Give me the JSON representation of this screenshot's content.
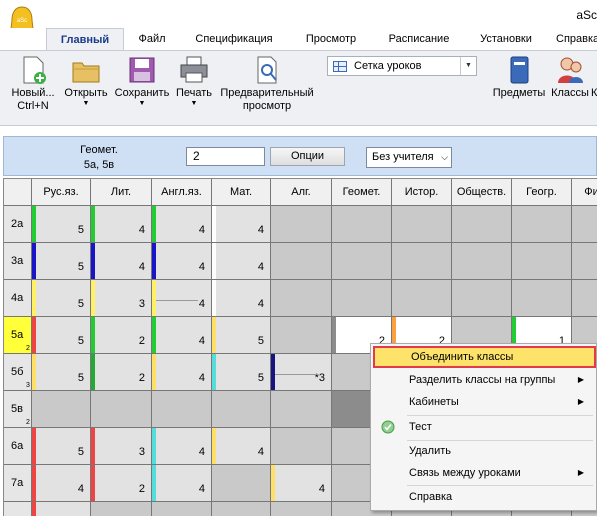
{
  "window": {
    "title": "aSc"
  },
  "tabs": [
    "Главный",
    "Файл",
    "Спецификация",
    "Просмотр",
    "Расписание",
    "Установки",
    "Справка"
  ],
  "ribbon": {
    "new": {
      "label": "Новый...",
      "shortcut": "Ctrl+N"
    },
    "open": "Открыть",
    "save": "Сохранить",
    "print": "Печать",
    "preview": [
      "Предварительный",
      "просмотр"
    ],
    "layout_select": "Сетка уроков",
    "subjects": "Предметы",
    "classes": "Классы",
    "more": "К"
  },
  "filter": {
    "subject": "Геомет.",
    "classes": "5а, 5в",
    "count": "2",
    "options_button": "Опции",
    "teacher": "Без учителя"
  },
  "grid": {
    "columns": [
      "Рус.яз.",
      "Лит.",
      "Англ.яз.",
      "Мат.",
      "Алг.",
      "Геомет.",
      "Истор.",
      "Обществ.",
      "Геогр.",
      "Фи"
    ],
    "rows": [
      {
        "label": "2а",
        "sub": "",
        "cells": [
          {
            "v": "5",
            "c": "#22cc33"
          },
          {
            "v": "4",
            "c": "#22cc33"
          },
          {
            "v": "4",
            "c": "#22cc33"
          },
          {
            "v": "4",
            "c": ""
          },
          {
            "v": "",
            "c": ""
          },
          {
            "v": "",
            "c": ""
          },
          {
            "v": "",
            "c": ""
          },
          {
            "v": "",
            "c": ""
          },
          {
            "v": "",
            "c": ""
          },
          {
            "v": "",
            "c": ""
          }
        ]
      },
      {
        "label": "3а",
        "sub": "",
        "cells": [
          {
            "v": "5",
            "c": "#1a14c8"
          },
          {
            "v": "4",
            "c": "#1a14c8"
          },
          {
            "v": "4",
            "c": "#1a14c8"
          },
          {
            "v": "4",
            "c": ""
          },
          {
            "v": "",
            "c": ""
          },
          {
            "v": "",
            "c": ""
          },
          {
            "v": "",
            "c": ""
          },
          {
            "v": "",
            "c": ""
          },
          {
            "v": "",
            "c": ""
          },
          {
            "v": "",
            "c": ""
          }
        ]
      },
      {
        "label": "4а",
        "sub": "",
        "cells": [
          {
            "v": "5",
            "c": "#fff066"
          },
          {
            "v": "3",
            "c": "#fff066"
          },
          {
            "v": "4",
            "c": "#fff066"
          },
          {
            "v": "4",
            "c": ""
          },
          {
            "v": "",
            "c": ""
          },
          {
            "v": "",
            "c": ""
          },
          {
            "v": "",
            "c": ""
          },
          {
            "v": "",
            "c": ""
          },
          {
            "v": "",
            "c": ""
          },
          {
            "v": "",
            "c": ""
          }
        ]
      },
      {
        "label": "5а",
        "sub": "2",
        "cells": [
          {
            "v": "5",
            "c": "#ee4444"
          },
          {
            "v": "2",
            "c": "#22cc33"
          },
          {
            "v": "4",
            "c": "#22cc33"
          },
          {
            "v": "5",
            "c": "#ffe066"
          },
          {
            "v": "",
            "c": ""
          },
          {
            "v": "2",
            "c": ""
          },
          {
            "v": "2",
            "c": "#ffa040"
          },
          {
            "v": "",
            "c": ""
          },
          {
            "v": "1",
            "c": "#22cc33"
          },
          {
            "v": "",
            "c": ""
          }
        ]
      },
      {
        "label": "5б",
        "sub": "3",
        "cells": [
          {
            "v": "5",
            "c": "#ffe066"
          },
          {
            "v": "2",
            "c": "#22aa33"
          },
          {
            "v": "4",
            "c": "#ffe066"
          },
          {
            "v": "5",
            "c": "#55dddd"
          },
          {
            "v": "*3",
            "c": "#1a1480"
          },
          {
            "v": "",
            "c": ""
          },
          {
            "v": "",
            "c": ""
          },
          {
            "v": "",
            "c": ""
          },
          {
            "v": "",
            "c": ""
          },
          {
            "v": "",
            "c": ""
          }
        ]
      },
      {
        "label": "5в",
        "sub": "2",
        "cells": [
          {
            "v": "",
            "c": ""
          },
          {
            "v": "",
            "c": ""
          },
          {
            "v": "",
            "c": ""
          },
          {
            "v": "",
            "c": ""
          },
          {
            "v": "",
            "c": ""
          },
          {
            "v": "",
            "c": ""
          },
          {
            "v": "",
            "c": ""
          },
          {
            "v": "",
            "c": ""
          },
          {
            "v": "",
            "c": ""
          },
          {
            "v": "",
            "c": ""
          }
        ]
      },
      {
        "label": "6а",
        "sub": "",
        "cells": [
          {
            "v": "5",
            "c": "#ee4444"
          },
          {
            "v": "3",
            "c": "#ee4444"
          },
          {
            "v": "4",
            "c": "#55dddd"
          },
          {
            "v": "4",
            "c": "#ffe066"
          },
          {
            "v": "",
            "c": ""
          },
          {
            "v": "",
            "c": ""
          },
          {
            "v": "",
            "c": ""
          },
          {
            "v": "",
            "c": ""
          },
          {
            "v": "",
            "c": ""
          },
          {
            "v": "",
            "c": ""
          }
        ]
      },
      {
        "label": "7а",
        "sub": "",
        "cells": [
          {
            "v": "4",
            "c": "#ee4444"
          },
          {
            "v": "2",
            "c": "#ee4444"
          },
          {
            "v": "4",
            "c": "#55dddd"
          },
          {
            "v": "",
            "c": ""
          },
          {
            "v": "4",
            "c": "#ffe066"
          },
          {
            "v": "",
            "c": ""
          },
          {
            "v": "",
            "c": ""
          },
          {
            "v": "",
            "c": ""
          },
          {
            "v": "",
            "c": ""
          },
          {
            "v": "",
            "c": ""
          }
        ]
      },
      {
        "label": "",
        "sub": "",
        "cells": [
          {
            "v": "",
            "c": "#ee4444"
          },
          {
            "v": "",
            "c": ""
          },
          {
            "v": "",
            "c": ""
          },
          {
            "v": "",
            "c": ""
          },
          {
            "v": "",
            "c": ""
          },
          {
            "v": "",
            "c": ""
          },
          {
            "v": "",
            "c": ""
          },
          {
            "v": "",
            "c": ""
          },
          {
            "v": "",
            "c": ""
          },
          {
            "v": "",
            "c": ""
          }
        ]
      }
    ]
  },
  "context_menu": {
    "items": [
      {
        "label": "Объединить классы",
        "highlighted": true
      },
      {
        "label": "Разделить классы на группы",
        "submenu": true
      },
      {
        "label": "Кабинеты",
        "submenu": true
      },
      {
        "label": "Тест",
        "icon": "check"
      },
      {
        "label": "Удалить"
      },
      {
        "label": "Связь между уроками",
        "submenu": true
      },
      {
        "label": "Справка"
      }
    ]
  },
  "colors": {
    "accent": "#1a3a8c",
    "selection": "#ffff3a",
    "highlight": "#fde36a",
    "highlight_border": "#e23a4a"
  }
}
